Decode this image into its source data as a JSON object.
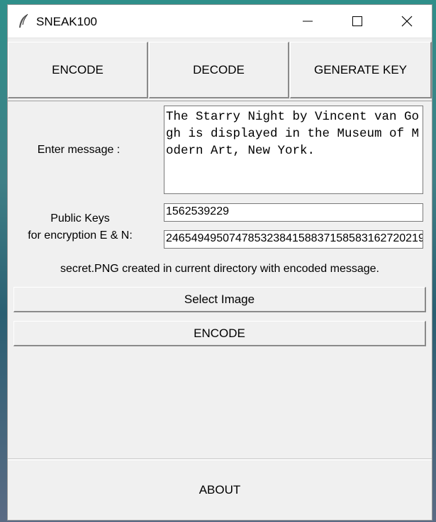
{
  "window": {
    "title": "SNEAK100",
    "icon": "feather-icon"
  },
  "titlebar_controls": [
    "minimize-icon",
    "maximize-icon",
    "close-icon"
  ],
  "tabs": [
    {
      "label": "ENCODE"
    },
    {
      "label": "DECODE"
    },
    {
      "label": "GENERATE KEY"
    }
  ],
  "form": {
    "message_label": "Enter message :",
    "message_value": "The Starry Night by Vincent van Gogh is displayed in the Museum of Modern Art, New York.",
    "keys_label_line1": "Public Keys",
    "keys_label_line2": "for encryption E & N:",
    "key_e": "1562539229",
    "key_n": "24654949507478532384158837158583162720219"
  },
  "status_text": "secret.PNG created in current directory with encoded message.",
  "actions": {
    "select_image": "Select Image",
    "encode": "ENCODE"
  },
  "footer": {
    "about": "ABOUT"
  }
}
